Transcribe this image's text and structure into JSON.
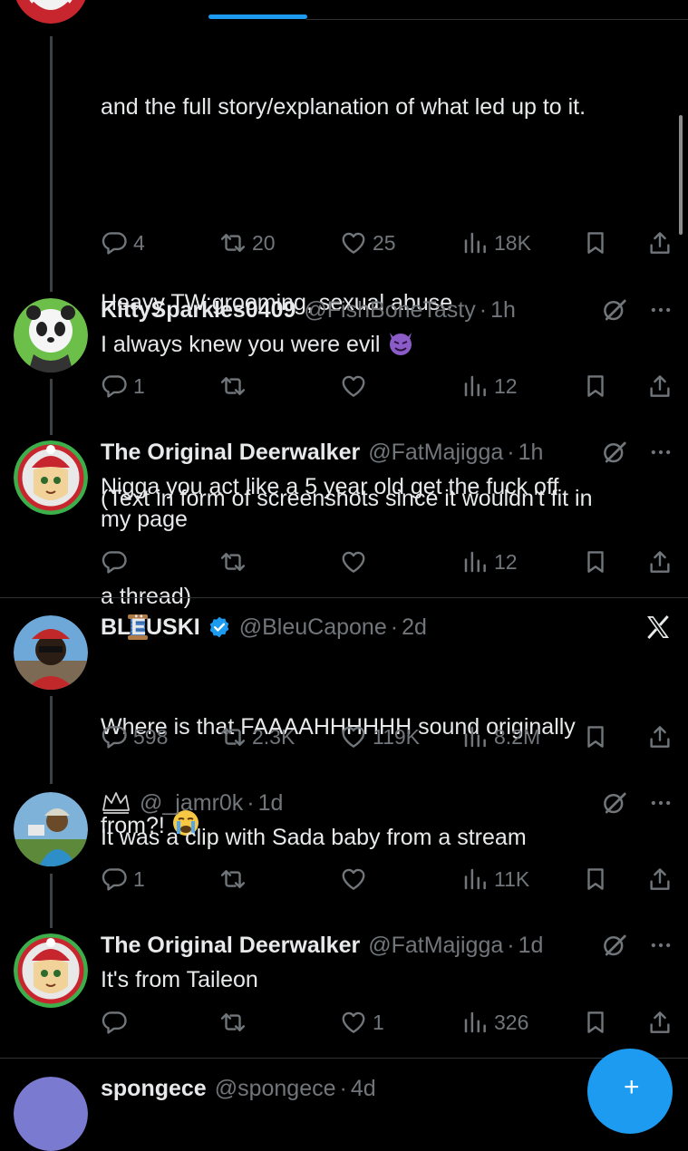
{
  "tweet0": {
    "text_line1": "and the full story/explanation of what led up to it.",
    "text_line2": "Heavy TW:grooming, sexual abuse",
    "text_line3": "(Text in form of screenshots since it wouldn't fit in",
    "text_line4": "a thread)",
    "replies": "4",
    "retweets": "20",
    "likes": "25",
    "views": "18K"
  },
  "reply1": {
    "name": "KittySparkles0409",
    "handle": "@FishBoneTasty",
    "time": "1h",
    "text": "I always knew you were evil",
    "replies": "1",
    "retweets": "",
    "likes": "",
    "views": "12"
  },
  "reply2": {
    "name": "The Original Deerwalker",
    "handle": "@FatMajigga",
    "time": "1h",
    "text": "Nigga you act like a 5 year old get the fuck off\nmy page",
    "replies": "",
    "retweets": "",
    "likes": "",
    "views": "12"
  },
  "tweet3": {
    "name": "BLËUSKI",
    "handle": "@BleuCapone",
    "time": "2d",
    "text_line1": "Where is that FAAAAHHHHHH sound originally",
    "text_line2": "from?!",
    "replies": "598",
    "retweets": "2.3K",
    "likes": "119K",
    "views": "8.2M"
  },
  "reply4": {
    "handle": "@_jamr0k",
    "time": "1d",
    "text": "It was a clip with Sada baby from a stream",
    "replies": "1",
    "retweets": "",
    "likes": "",
    "views": "11K"
  },
  "reply5": {
    "name": "The Original Deerwalker",
    "handle": "@FatMajigga",
    "time": "1d",
    "text": "It's from Taileon",
    "replies": "",
    "retweets": "",
    "likes": "1",
    "views": "326"
  },
  "next": {
    "name": "spongece",
    "handle": "@spongece",
    "time": "4d"
  },
  "colors": {
    "background": "#000000",
    "text": "#e7e9ea",
    "muted": "#71767b",
    "accent": "#1d9bf0",
    "verified": "#1d9bf0"
  },
  "icons": [
    "reply-icon",
    "retweet-icon",
    "like-icon",
    "views-icon",
    "bookmark-icon",
    "share-icon",
    "grok-icon",
    "more-icon",
    "x-logo-icon",
    "verified-icon"
  ]
}
